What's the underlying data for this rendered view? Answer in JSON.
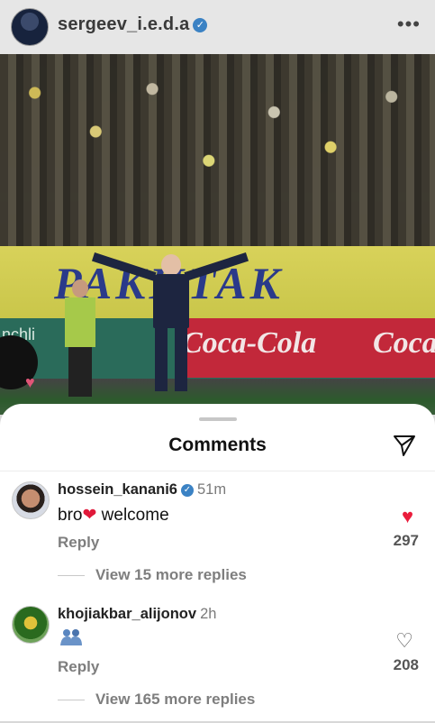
{
  "post": {
    "username": "sergeev_i.e.d.a",
    "verified_glyph": "✓",
    "more_glyph": "•••",
    "photo": {
      "banner_text": "PAKHTAK",
      "ad_left_text": "Coca-Cola",
      "ad_right_text": "Coca",
      "side_text": "nchli\nkal",
      "heart_glyph": "♥"
    }
  },
  "comments_sheet": {
    "title": "Comments",
    "share_icon": "send-icon",
    "comments": [
      {
        "username": "hossein_kanani6",
        "verified": true,
        "time": "51m",
        "text_before": "bro",
        "heart": "❤",
        "text_after": "welcome",
        "reply_label": "Reply",
        "liked": true,
        "like_glyph": "♥",
        "like_count": "297",
        "more_replies": "View 15 more replies"
      },
      {
        "username": "khojiakbar_alijonov",
        "verified": false,
        "time": "2h",
        "emoji": "people-hugging",
        "reply_label": "Reply",
        "liked": false,
        "like_glyph": "♡",
        "like_count": "208",
        "more_replies": "View 165 more replies"
      }
    ]
  },
  "colors": {
    "like_red": "#ea1d3c",
    "verified_blue": "#3b82c4",
    "muted_text": "#7e7e7e"
  }
}
